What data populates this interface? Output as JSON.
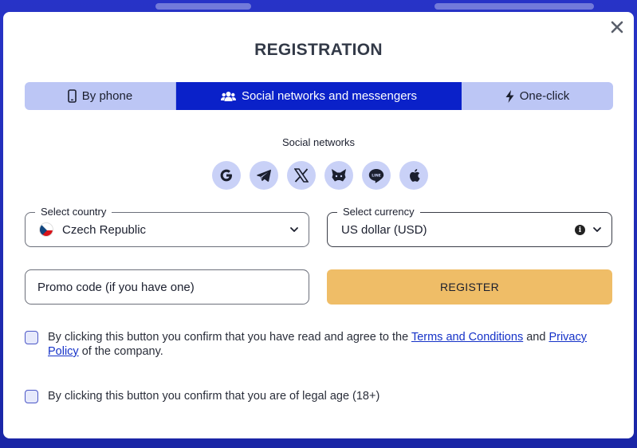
{
  "modal": {
    "title": "REGISTRATION",
    "close_icon": "close-icon"
  },
  "tabs": [
    {
      "label": "By phone",
      "icon": "phone-icon",
      "active": false
    },
    {
      "label": "Social networks and messengers",
      "icon": "users-icon",
      "active": true
    },
    {
      "label": "One-click",
      "icon": "lightning-icon",
      "active": false
    }
  ],
  "social": {
    "label": "Social networks",
    "providers": [
      "google-icon",
      "telegram-icon",
      "x-icon",
      "metamask-icon",
      "line-icon",
      "apple-icon"
    ]
  },
  "country": {
    "legend": "Select country",
    "value": "Czech Republic",
    "flag": "czech-flag-icon"
  },
  "currency": {
    "legend": "Select currency",
    "value": "US dollar (USD)"
  },
  "promo": {
    "placeholder": "Promo code (if you have one)"
  },
  "register": {
    "label": "REGISTER"
  },
  "consent": {
    "terms_prefix": "By clicking this button you confirm that you have read and agree to the ",
    "terms_link": "Terms and Conditions",
    "terms_and": " and ",
    "privacy_link": "Privacy Policy",
    "terms_suffix": " of the company.",
    "age_text": "By clicking this button you confirm that you are of legal age (18+)"
  },
  "colors": {
    "accent": "#0a21c9",
    "tab_bg": "#bcc6f5",
    "register_bg": "#efbd67",
    "backdrop": "#1c2ab8"
  }
}
